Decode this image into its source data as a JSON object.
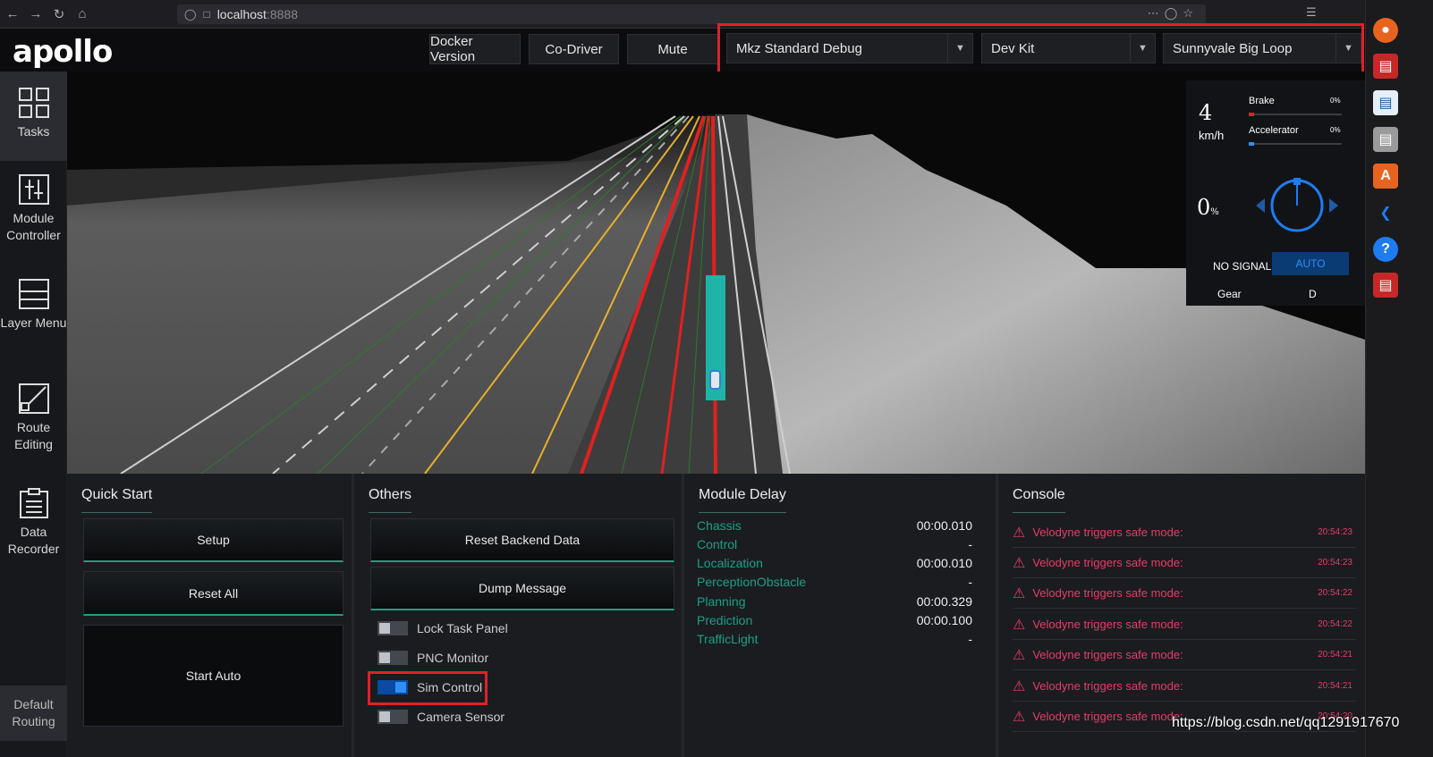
{
  "browser": {
    "url_host": "localhost",
    "url_port": ":8888"
  },
  "header": {
    "logo": "apollo",
    "buttons": [
      "Docker Version",
      "Co-Driver",
      "Mute"
    ],
    "selects": [
      "Mkz Standard Debug",
      "Dev Kit",
      "Sunnyvale Big Loop"
    ]
  },
  "sidebar": {
    "items": [
      {
        "label": "Tasks",
        "icon": "grid-icon"
      },
      {
        "label": "Module Controller",
        "icon": "sliders-icon"
      },
      {
        "label": "Layer Menu",
        "icon": "layers-icon"
      },
      {
        "label": "Route Editing",
        "icon": "route-icon"
      },
      {
        "label": "Data Recorder",
        "icon": "clipboard-icon"
      }
    ],
    "default_routing": "Default Routing"
  },
  "dashboard": {
    "speed": "4",
    "speed_unit": "km/h",
    "brake_label": "Brake",
    "brake_pct": "0%",
    "brake_value": 0,
    "accel_label": "Accelerator",
    "accel_pct": "0%",
    "accel_value": 0,
    "steering": "0",
    "steering_unit": "%",
    "signal": "NO SIGNAL",
    "mode": "AUTO",
    "gear_label": "Gear",
    "gear": "D"
  },
  "quick_start": {
    "title": "Quick Start",
    "buttons": [
      "Setup",
      "Reset All",
      "Start Auto"
    ]
  },
  "others": {
    "title": "Others",
    "buttons": [
      "Reset Backend Data",
      "Dump Message"
    ],
    "toggles": [
      {
        "label": "Lock Task Panel",
        "on": false
      },
      {
        "label": "PNC Monitor",
        "on": false
      },
      {
        "label": "Sim Control",
        "on": true
      },
      {
        "label": "Camera Sensor",
        "on": false
      }
    ]
  },
  "module_delay": {
    "title": "Module Delay",
    "rows": [
      {
        "name": "Chassis",
        "value": "00:00.010"
      },
      {
        "name": "Control",
        "value": "-"
      },
      {
        "name": "Localization",
        "value": "00:00.010"
      },
      {
        "name": "PerceptionObstacle",
        "value": "-"
      },
      {
        "name": "Planning",
        "value": "00:00.329"
      },
      {
        "name": "Prediction",
        "value": "00:00.100"
      },
      {
        "name": "TrafficLight",
        "value": "-"
      }
    ]
  },
  "console": {
    "title": "Console",
    "messages": [
      {
        "text": "Velodyne triggers safe mode:",
        "time": "20:54:23"
      },
      {
        "text": "Velodyne triggers safe mode:",
        "time": "20:54:23"
      },
      {
        "text": "Velodyne triggers safe mode:",
        "time": "20:54:22"
      },
      {
        "text": "Velodyne triggers safe mode:",
        "time": "20:54:22"
      },
      {
        "text": "Velodyne triggers safe mode:",
        "time": "20:54:21"
      },
      {
        "text": "Velodyne triggers safe mode:",
        "time": "20:54:21"
      },
      {
        "text": "Velodyne triggers safe mode:",
        "time": "20:54:20"
      }
    ]
  },
  "watermark": "https://blog.csdn.net/qq1291917670",
  "colors": {
    "accent": "#1aa086",
    "highlight": "#e0202a",
    "console_error": "#e83c67",
    "auto_blue": "#2f8ff5"
  }
}
